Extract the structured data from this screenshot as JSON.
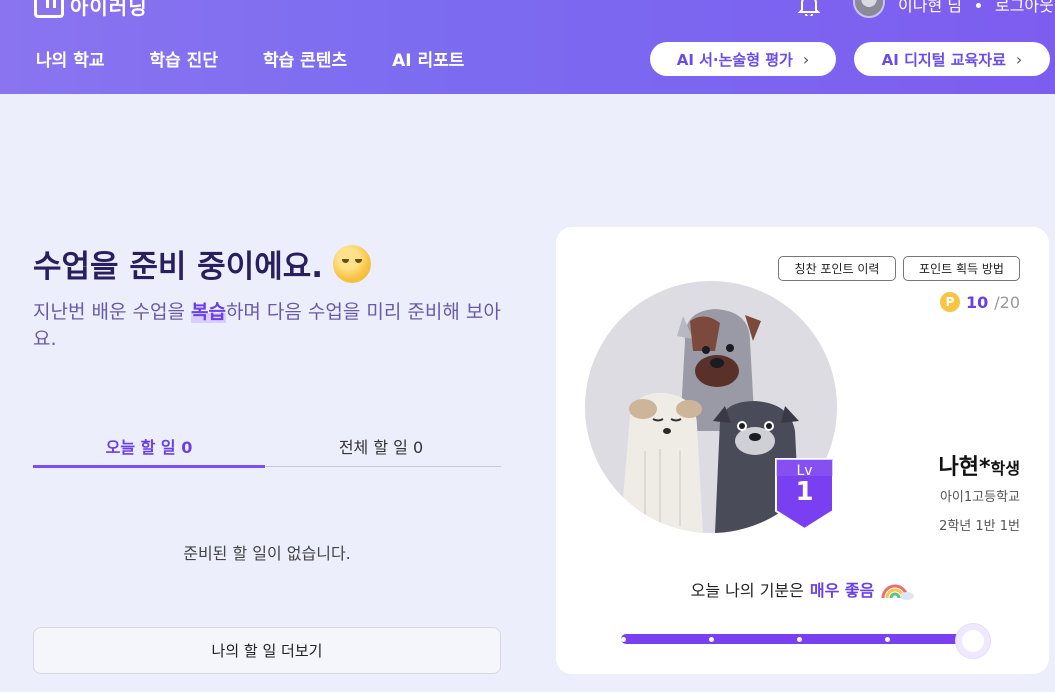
{
  "header": {
    "logo_text": "아이러닝",
    "user_name": "이나현 님",
    "logout": "로그아웃",
    "nav": [
      "나의 학교",
      "학습 진단",
      "학습 콘텐츠",
      "AI 리포트"
    ],
    "buttons": [
      {
        "label": "AI 서·논술형 평가",
        "icon": "chevron-right-icon"
      },
      {
        "label": "AI 디지털 교육자료",
        "icon": "chevron-right-icon"
      }
    ]
  },
  "main": {
    "title": "수업을 준비 중이에요.",
    "subtitle_before": "지난번 배운 수업을 ",
    "subtitle_highlight": "복습",
    "subtitle_after": "하며 다음 수업을 미리 준비해 보아요.",
    "tabs": [
      {
        "label": "오늘 할 일 0",
        "active": true
      },
      {
        "label": "전체 할 일 0",
        "active": false
      }
    ],
    "empty_message": "준비된 할 일이 없습니다.",
    "more_button": "나의 할 일 더보기"
  },
  "profile": {
    "btn_history": "칭찬 포인트 이력",
    "btn_how": "포인트 획득 방법",
    "point_badge": "P",
    "points_current": "10",
    "points_total": "/20",
    "level_label": "Lv",
    "level_value": "1",
    "name": "나현*",
    "role": "학생",
    "school": "아이1고등학교",
    "class_info": "2학년 1반 1번",
    "mood_prefix": "오늘 나의 기분은",
    "mood_value": "매우 좋음",
    "mood_level": 1.0,
    "accent": "#7a3ff0"
  }
}
